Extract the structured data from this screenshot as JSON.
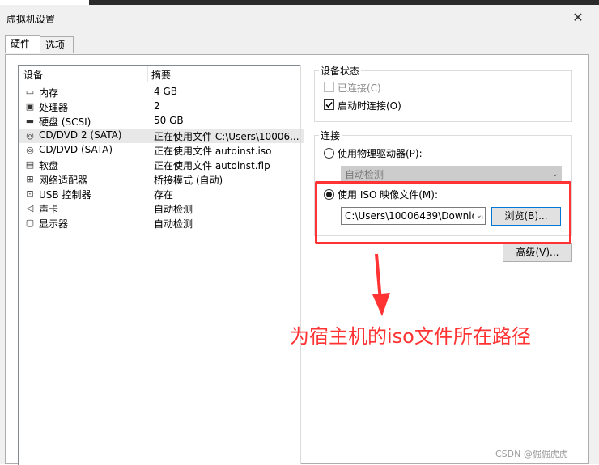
{
  "window": {
    "title": "虚拟机设置"
  },
  "tabs": [
    {
      "label": "硬件"
    },
    {
      "label": "选项"
    }
  ],
  "device_list": {
    "headers": {
      "device": "设备",
      "summary": "摘要"
    },
    "rows": [
      {
        "icon": "memory-icon",
        "name": "内存",
        "summary": "4 GB"
      },
      {
        "icon": "processor-icon",
        "name": "处理器",
        "summary": "2"
      },
      {
        "icon": "hard-disk-icon",
        "name": "硬盘 (SCSI)",
        "summary": "50 GB"
      },
      {
        "icon": "cd-dvd-icon",
        "name": "CD/DVD 2 (SATA)",
        "summary": "正在使用文件 C:\\Users\\10006..."
      },
      {
        "icon": "cd-dvd-icon",
        "name": "CD/DVD (SATA)",
        "summary": "正在使用文件 autoinst.iso"
      },
      {
        "icon": "floppy-icon",
        "name": "软盘",
        "summary": "正在使用文件 autoinst.flp"
      },
      {
        "icon": "network-adapter-icon",
        "name": "网络适配器",
        "summary": "桥接模式 (自动)"
      },
      {
        "icon": "usb-icon",
        "name": "USB 控制器",
        "summary": "存在"
      },
      {
        "icon": "sound-card-icon",
        "name": "声卡",
        "summary": "自动检测"
      },
      {
        "icon": "display-icon",
        "name": "显示器",
        "summary": "自动检测"
      }
    ],
    "selected_index": 3
  },
  "device_status": {
    "title": "设备状态",
    "connected_label": "已连接(C)",
    "connected_checked": false,
    "connect_at_power_on_label": "启动时连接(O)",
    "connect_at_power_on_checked": true
  },
  "connection": {
    "title": "连接",
    "physical_drive_label": "使用物理驱动器(P):",
    "physical_drive_value": "自动检测",
    "iso_label": "使用 ISO 映像文件(M):",
    "iso_path": "C:\\Users\\10006439\\Downloa",
    "browse_label": "浏览(B)...",
    "selected": "iso"
  },
  "advanced_button_label": "高级(V)...",
  "annotation": {
    "text": "为宿主机的iso文件所在路径",
    "color": "#ff3333"
  },
  "watermark": "CSDN @倔倔虎虎"
}
